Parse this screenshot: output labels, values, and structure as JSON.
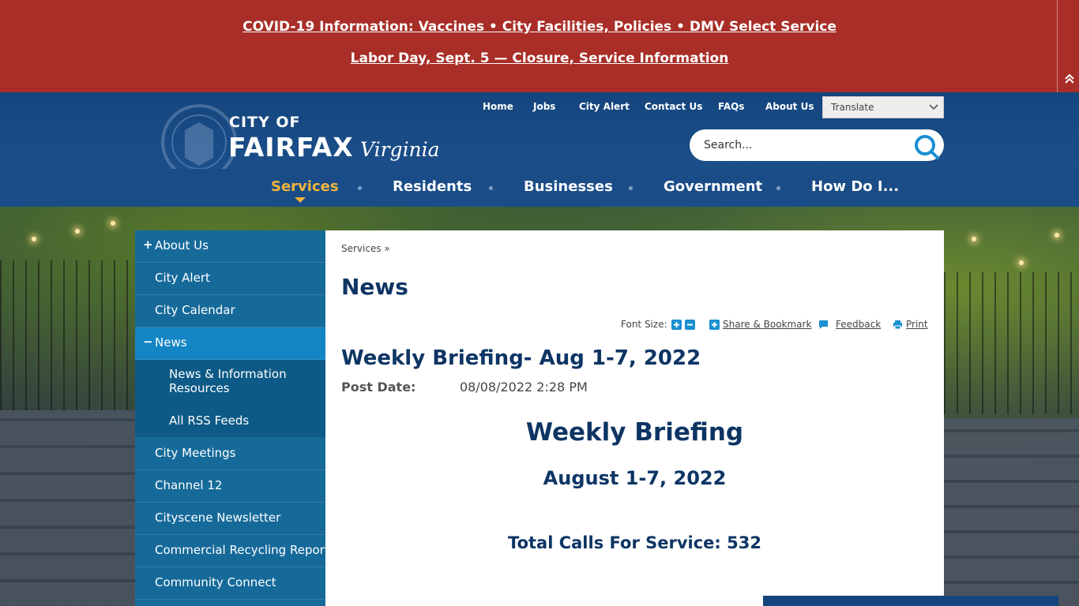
{
  "alert": {
    "line1": "COVID-19 Information: Vaccines • City Facilities, Policies • DMV Select Service",
    "line2": "Labor Day, Sept. 5 — Closure, Service Information"
  },
  "logo": {
    "city_of": "CITY OF",
    "fairfax": "FAIRFAX",
    "virginia": "Virginia"
  },
  "top_nav": {
    "items": [
      "Home",
      "Jobs",
      "City Alert",
      "Contact Us",
      "FAQs",
      "About Us"
    ],
    "translate_label": "Translate"
  },
  "search": {
    "placeholder": "Search..."
  },
  "main_nav": {
    "items": [
      "Services",
      "Residents",
      "Businesses",
      "Government",
      "How Do I..."
    ],
    "active": "Services"
  },
  "side_nav": {
    "items": [
      {
        "label": "About Us",
        "mark": "+"
      },
      {
        "label": "City Alert"
      },
      {
        "label": "City Calendar"
      },
      {
        "label": "News",
        "mark": "−"
      },
      {
        "label": "City Meetings"
      },
      {
        "label": "Channel 12"
      },
      {
        "label": "Cityscene Newsletter"
      },
      {
        "label": "Commercial Recycling Report"
      },
      {
        "label": "Community Connect"
      }
    ],
    "sub_items": [
      "News & Information Resources",
      "All RSS Feeds"
    ],
    "sub_item_1_line1": "News & Information",
    "sub_item_1_line2": "Resources"
  },
  "content": {
    "breadcrumb": "Services »",
    "page_title": "News",
    "tools": {
      "font_size_label": "Font Size:",
      "share_label": "Share & Bookmark",
      "feedback_label": "Feedback",
      "print_label": "Print"
    },
    "article_title": "Weekly Briefing- Aug 1-7, 2022",
    "post_date_label": "Post Date:",
    "post_date_value": "08/08/2022 2:28 PM",
    "brief_heading": "Weekly Briefing",
    "brief_dates": "August 1-7, 2022",
    "total_calls": "Total Calls For Service: 532"
  },
  "colors": {
    "alert_red": "#a82e27",
    "header_blue": "#14457e",
    "nav_active": "#f0b43c",
    "side_nav": "#166a9a",
    "side_current": "#1485c4",
    "title_navy": "#0d3564",
    "icon_blue": "#1a8fd1"
  }
}
